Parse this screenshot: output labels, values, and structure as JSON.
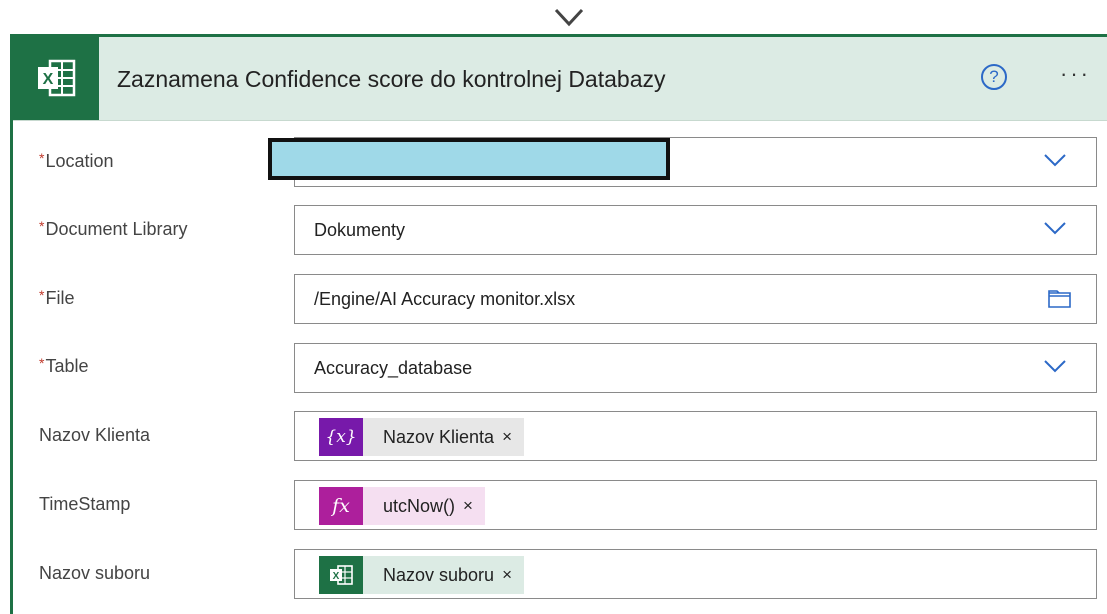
{
  "card": {
    "title": "Zaznamena Confidence score do kontrolnej Databazy",
    "help_glyph": "?",
    "more_glyph": "···",
    "accent_color": "#1e7145",
    "header_bg": "#dcebe4"
  },
  "fields": {
    "location": {
      "required": "*",
      "label": "Location",
      "value": ""
    },
    "document_library": {
      "required": "*",
      "label": "Document Library",
      "value": "Dokumenty"
    },
    "file": {
      "required": "*",
      "label": "File",
      "value": "/Engine/AI Accuracy monitor.xlsx"
    },
    "table": {
      "required": "*",
      "label": "Table",
      "value": "Accuracy_database"
    },
    "nazov_klienta": {
      "label": "Nazov Klienta",
      "token": {
        "icon": "variable-icon",
        "icon_text": "{x}",
        "text": "Nazov Klienta",
        "remove": "×",
        "color": "#7719aa",
        "bg": "#e7e7e7"
      }
    },
    "timestamp": {
      "label": "TimeStamp",
      "token": {
        "icon": "function-icon",
        "icon_text": "fx",
        "text": "utcNow()",
        "remove": "×",
        "color": "#ad1f9c",
        "bg": "#f5dff1"
      }
    },
    "nazov_suboru": {
      "label": "Nazov suboru",
      "token": {
        "icon": "excel-icon",
        "text": "Nazov suboru",
        "remove": "×",
        "color": "#1e7145",
        "bg": "#dcebe4"
      }
    }
  }
}
